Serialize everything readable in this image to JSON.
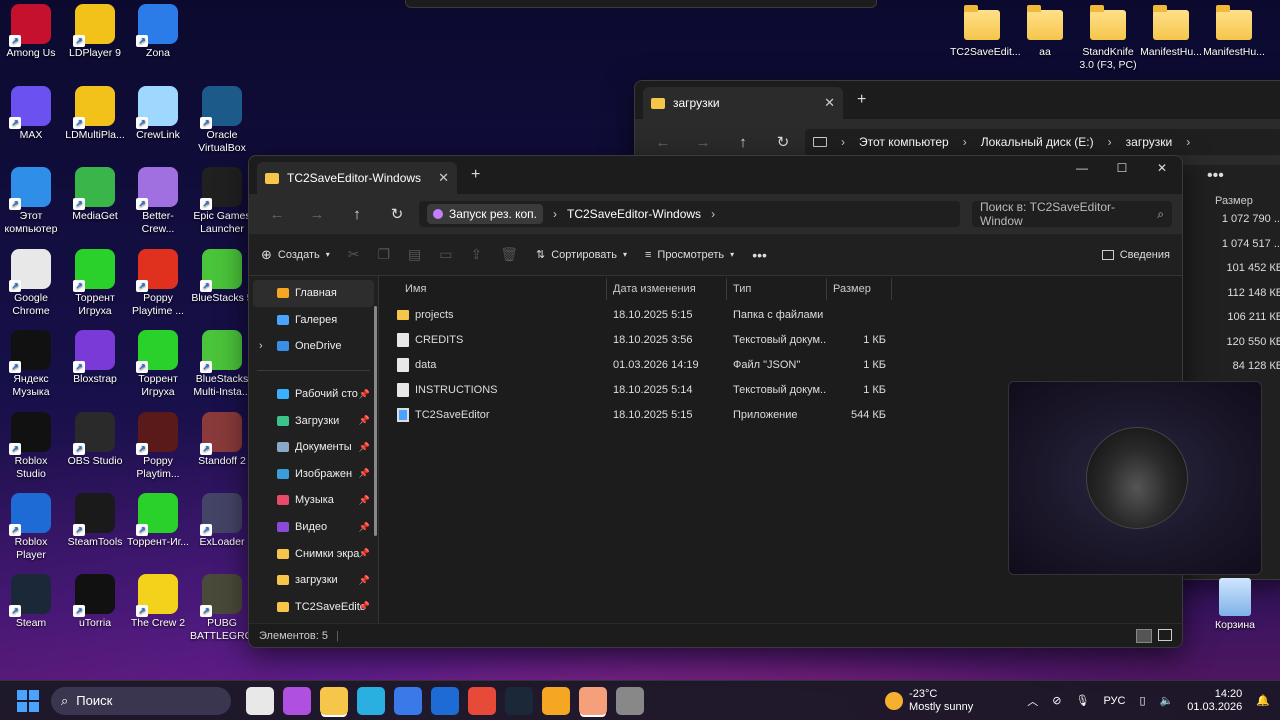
{
  "desktop_left": [
    {
      "label": "Among Us",
      "color": "#c5112d"
    },
    {
      "label": "LDPlayer 9",
      "color": "#f2c21a"
    },
    {
      "label": "Zona",
      "color": "#2b7be8"
    },
    {
      "label": "MAX",
      "color": "#6b52f0"
    },
    {
      "label": "LDMultiPla...",
      "color": "#f2c21a"
    },
    {
      "label": "CrewLink",
      "color": "#9fd8ff"
    },
    {
      "label": "Oracle VirtualBox",
      "color": "#1c5a8a"
    },
    {
      "label": "Этот компьютер",
      "color": "#2f8ee8"
    },
    {
      "label": "MediaGet",
      "color": "#3ab54a"
    },
    {
      "label": "Better-Crew...",
      "color": "#a070e0"
    },
    {
      "label": "Epic Games Launcher",
      "color": "#202020"
    },
    {
      "label": "Google Chrome",
      "color": "#e8e8e8"
    },
    {
      "label": "Торрент Игруха",
      "color": "#2ad12a"
    },
    {
      "label": "Poppy Playtime ...",
      "color": "#e0301e"
    },
    {
      "label": "BlueStacks 5",
      "color": "#4ac43a"
    },
    {
      "label": "Яндекс Музыка",
      "color": "#111111"
    },
    {
      "label": "Bloxstrap",
      "color": "#7a3ad8"
    },
    {
      "label": "Торрент Игруха",
      "color": "#2ad12a"
    },
    {
      "label": "BlueStacks Multi-Insta...",
      "color": "#4ac43a"
    },
    {
      "label": "Roblox Studio",
      "color": "#111111"
    },
    {
      "label": "OBS Studio",
      "color": "#2a2a2a"
    },
    {
      "label": "Poppy Playtim...",
      "color": "#5a1a1a"
    },
    {
      "label": "Standoff 2",
      "color": "#8a3a3a"
    },
    {
      "label": "Roblox Player",
      "color": "#1e6bd6"
    },
    {
      "label": "SteamTools",
      "color": "#1a1a1a"
    },
    {
      "label": "Торрент-Иг...",
      "color": "#2ad12a"
    },
    {
      "label": "ExLoader",
      "color": "#444466"
    },
    {
      "label": "Steam",
      "color": "#1b2838"
    },
    {
      "label": "uTorria",
      "color": "#111111"
    },
    {
      "label": "The Crew 2",
      "color": "#f2d21a"
    },
    {
      "label": "PUBG BATTLEGRO...",
      "color": "#4a4a3a"
    }
  ],
  "desktop_top_right": [
    {
      "label": "TC2SaveEdit..."
    },
    {
      "label": "aa"
    },
    {
      "label": "StandKnife 3.0 (F3, PC)"
    },
    {
      "label": "ManifestHu..."
    },
    {
      "label": "ManifestHu..."
    }
  ],
  "recycle_bin": "Корзина",
  "back_window": {
    "tab_title": "загрузки",
    "breadcrumb": [
      "Этот компьютер",
      "Локальный диск (E:)",
      "загрузки"
    ],
    "size_header": "Размер",
    "sizes": [
      "1 072 790 ...",
      "1 074 517 ...",
      "101 452 КБ",
      "112 148 КБ",
      "106 211 КБ",
      "120 550 КБ",
      "84 128 КБ",
      "",
      "",
      "",
      "",
      ""
    ]
  },
  "front_window": {
    "tab_title": "TC2SaveEditor-Windows",
    "breadcrumb_chip": "Запуск рез. коп.",
    "breadcrumb": "TC2SaveEditor-Windows",
    "search_placeholder": "Поиск в: TC2SaveEditor-Window",
    "toolbar": {
      "create": "Создать",
      "sort": "Сортировать",
      "view": "Просмотреть",
      "details": "Сведения"
    },
    "sidebar": [
      {
        "label": "Главная",
        "color": "#f5a623",
        "selected": true,
        "pinned": false
      },
      {
        "label": "Галерея",
        "color": "#4aa3ff",
        "selected": false,
        "pinned": false
      },
      {
        "label": "OneDrive",
        "color": "#3a8ee6",
        "selected": false,
        "pinned": false
      },
      {
        "label": "Рабочий сто",
        "color": "#3ab0ff",
        "selected": false,
        "pinned": true
      },
      {
        "label": "Загрузки",
        "color": "#3ac48a",
        "selected": false,
        "pinned": true
      },
      {
        "label": "Документы",
        "color": "#8aa8c8",
        "selected": false,
        "pinned": true
      },
      {
        "label": "Изображен",
        "color": "#3a9ed8",
        "selected": false,
        "pinned": true
      },
      {
        "label": "Музыка",
        "color": "#e84a6a",
        "selected": false,
        "pinned": true
      },
      {
        "label": "Видео",
        "color": "#8a4ad8",
        "selected": false,
        "pinned": true
      },
      {
        "label": "Снимки экра",
        "color": "#f5c64a",
        "selected": false,
        "pinned": true
      },
      {
        "label": "загрузки",
        "color": "#f5c64a",
        "selected": false,
        "pinned": true
      },
      {
        "label": "TC2SaveEdito",
        "color": "#f5c64a",
        "selected": false,
        "pinned": true
      }
    ],
    "columns": [
      "Имя",
      "Дата изменения",
      "Тип",
      "Размер"
    ],
    "files": [
      {
        "name": "projects",
        "date": "18.10.2025 5:15",
        "type": "Папка с файлами",
        "size": "",
        "kind": "folder"
      },
      {
        "name": "CREDITS",
        "date": "18.10.2025 3:56",
        "type": "Текстовый докум...",
        "size": "1 КБ",
        "kind": "doc"
      },
      {
        "name": "data",
        "date": "01.03.2026 14:19",
        "type": "Файл \"JSON\"",
        "size": "1 КБ",
        "kind": "doc"
      },
      {
        "name": "INSTRUCTIONS",
        "date": "18.10.2025 5:14",
        "type": "Текстовый докум...",
        "size": "1 КБ",
        "kind": "doc"
      },
      {
        "name": "TC2SaveEditor",
        "date": "18.10.2025 5:15",
        "type": "Приложение",
        "size": "544 КБ",
        "kind": "app"
      }
    ],
    "status": "Элементов: 5"
  },
  "taskbar": {
    "search": "Поиск",
    "weather_temp": "-23°C",
    "weather_text": "Mostly sunny",
    "lang": "РУС",
    "time": "14:20",
    "date": "01.03.2026",
    "apps": [
      "#e8e8e8",
      "#b050e0",
      "#f5c64a",
      "#2ab0e0",
      "#3a7ae8",
      "#1e6bd6",
      "#e84a3a",
      "#1b2838",
      "#f5a623",
      "#f5a07a",
      "#888888"
    ]
  }
}
